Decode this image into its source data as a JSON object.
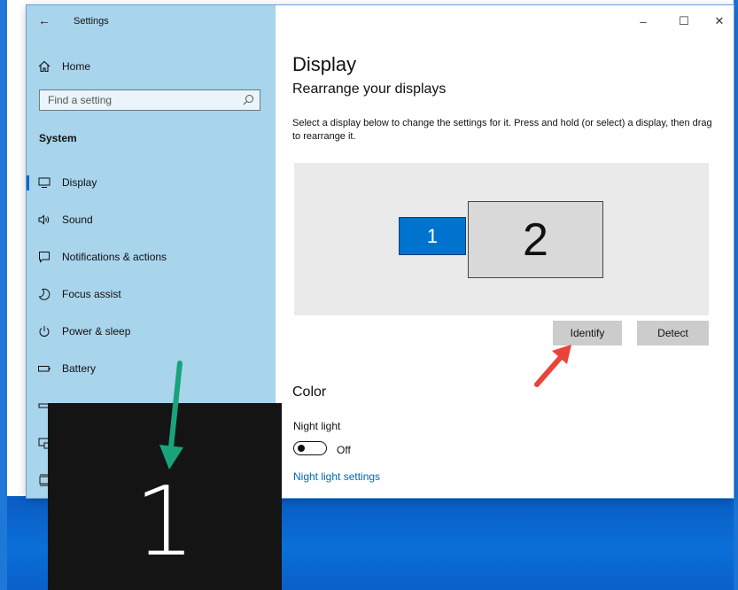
{
  "window": {
    "title": "Settings",
    "back_glyph": "←",
    "controls": {
      "minimize": "–",
      "maximize": "☐",
      "close": "✕"
    }
  },
  "sidebar": {
    "home_label": "Home",
    "search_placeholder": "Find a setting",
    "section_title": "System",
    "items": [
      {
        "label": "Display",
        "icon": "monitor-icon",
        "active": true
      },
      {
        "label": "Sound",
        "icon": "speaker-icon"
      },
      {
        "label": "Notifications & actions",
        "icon": "notification-icon"
      },
      {
        "label": "Focus assist",
        "icon": "moon-icon"
      },
      {
        "label": "Power & sleep",
        "icon": "power-icon"
      },
      {
        "label": "Battery",
        "icon": "battery-icon"
      }
    ]
  },
  "main": {
    "title": "Display",
    "subtitle": "Rearrange your displays",
    "description": "Select a display below to change the settings for it. Press and hold (or select) a display, then drag to rearrange it.",
    "displays": [
      {
        "number": "1",
        "selected": true
      },
      {
        "number": "2",
        "selected": false
      }
    ],
    "identify_button": "Identify",
    "detect_button": "Detect",
    "color_title": "Color",
    "night_light_label": "Night light",
    "night_light_state": "Off",
    "night_light_link": "Night light settings"
  },
  "identify_overlay": {
    "number": "1"
  },
  "colors": {
    "sidebar_bg": "#a8d4ec",
    "accent": "#0073cf",
    "link": "#0066b4",
    "annotation_green": "#1aa37a",
    "annotation_red": "#e8443a"
  }
}
